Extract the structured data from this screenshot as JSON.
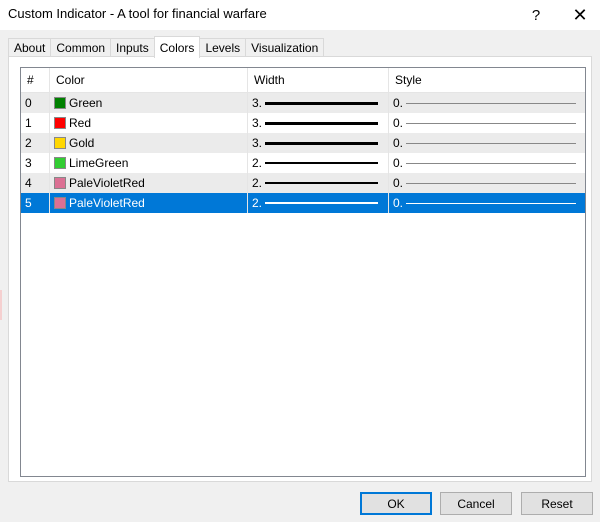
{
  "window": {
    "title": "Custom Indicator - A tool for financial warfare",
    "help_label": "?",
    "close_label": "✕"
  },
  "tabs": [
    {
      "label": "About"
    },
    {
      "label": "Common"
    },
    {
      "label": "Inputs"
    },
    {
      "label": "Colors",
      "active": true
    },
    {
      "label": "Levels"
    },
    {
      "label": "Visualization"
    }
  ],
  "table": {
    "headers": [
      "#",
      "Color",
      "Width",
      "Style"
    ],
    "rows": [
      {
        "index": "0",
        "color_name": "Green",
        "swatch": "#008000",
        "width": "3.",
        "style": "0."
      },
      {
        "index": "1",
        "color_name": "Red",
        "swatch": "#ff0000",
        "width": "3.",
        "style": "0."
      },
      {
        "index": "2",
        "color_name": "Gold",
        "swatch": "#ffd700",
        "width": "3.",
        "style": "0."
      },
      {
        "index": "3",
        "color_name": "LimeGreen",
        "swatch": "#32cd32",
        "width": "2.",
        "style": "0."
      },
      {
        "index": "4",
        "color_name": "PaleVioletRed",
        "swatch": "#db7093",
        "width": "2.",
        "style": "0."
      },
      {
        "index": "5",
        "color_name": "PaleVioletRed",
        "swatch": "#db7093",
        "width": "2.",
        "style": "0.",
        "selected": true
      }
    ]
  },
  "buttons": {
    "ok": "OK",
    "cancel": "Cancel",
    "reset": "Reset"
  }
}
